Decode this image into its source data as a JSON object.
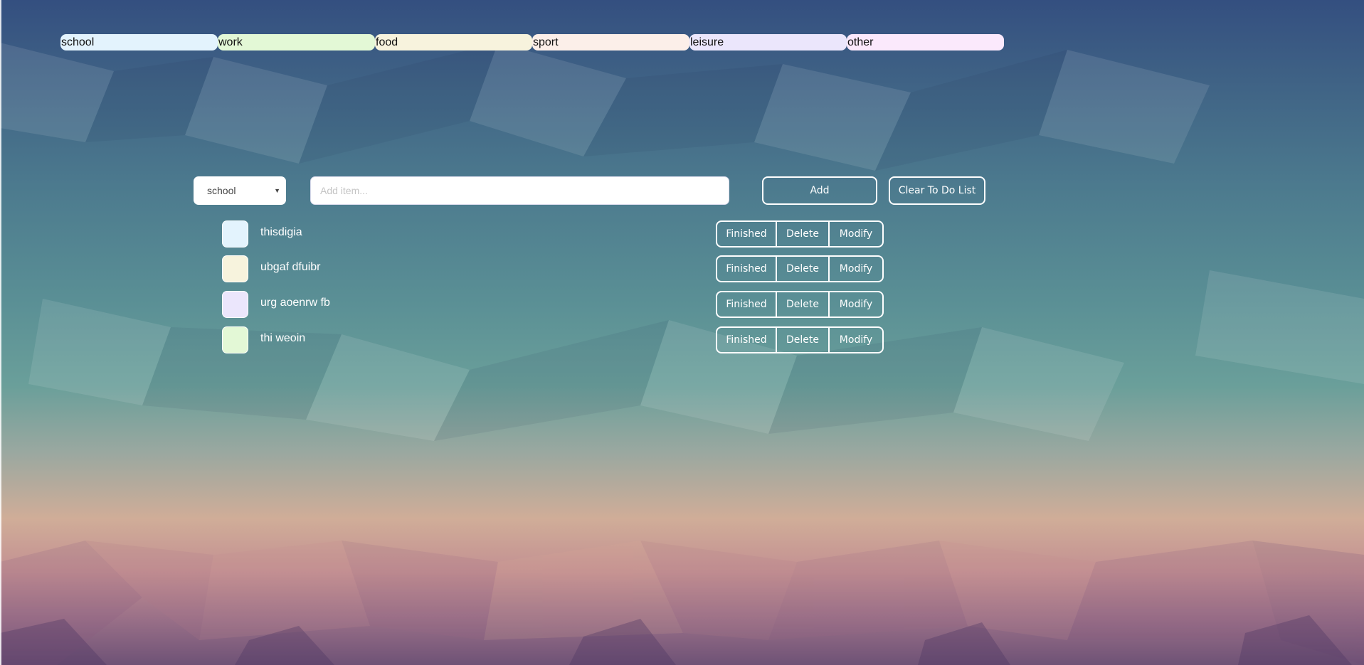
{
  "categories": [
    {
      "label": "school",
      "color": "#e3f3fd"
    },
    {
      "label": "work",
      "color": "#e3f8d6"
    },
    {
      "label": "food",
      "color": "#f7f3dd"
    },
    {
      "label": "sport",
      "color": "#fcefe9"
    },
    {
      "label": "leisure",
      "color": "#ebe6fc"
    },
    {
      "label": "other",
      "color": "#fbe9fc"
    }
  ],
  "controls": {
    "category_select_value": "school",
    "item_input_placeholder": "Add item...",
    "item_input_value": "",
    "add_label": "Add",
    "clear_label": "Clear To Do List"
  },
  "todos": [
    {
      "text": "thisdigia",
      "color": "#e3f3fd"
    },
    {
      "text": "ubgaf dfuibr",
      "color": "#f7f3dd"
    },
    {
      "text": "urg aoenrw fb",
      "color": "#ebe6fc"
    },
    {
      "text": "thi weoin",
      "color": "#e3f8d6"
    }
  ],
  "actions": {
    "finished_label": "Finished",
    "delete_label": "Delete",
    "modify_label": "Modify"
  }
}
